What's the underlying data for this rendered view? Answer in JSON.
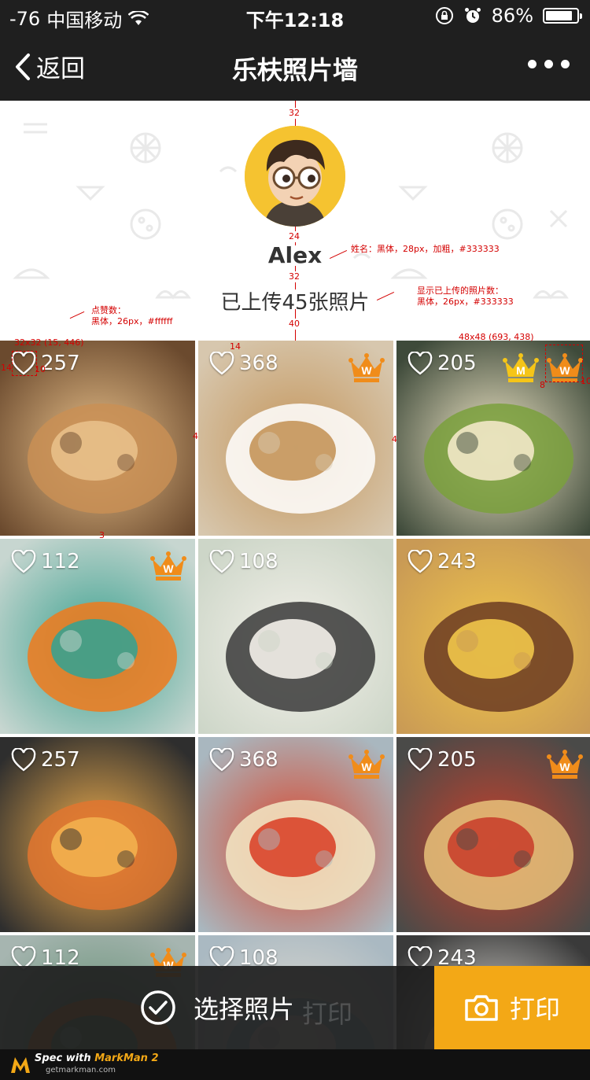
{
  "status_bar": {
    "signal": "-76",
    "carrier": "中国移动",
    "time": "下午12:18",
    "battery": "86%",
    "battery_level": 0.86
  },
  "nav": {
    "back_label": "返回",
    "title": "乐枎照片墙",
    "more_icon": "more-dots-icon"
  },
  "profile": {
    "name": "Alex",
    "upload_text": "已上传45张照片"
  },
  "spec_notes": {
    "top_gap": "32",
    "avatar_gap": "24",
    "name_gap": "32",
    "count_gap": "40",
    "name_note": "姓名：黑体，28px，加粗，#333333",
    "count_note_1": "显示已上传的照片数：",
    "count_note_2": "黑体，26px，#333333",
    "likes_note_1": "点赞数：",
    "likes_note_2": "黑体，26px，#ffffff",
    "heart_size": "32x32 (15, 446)",
    "crown_size": "48x48 (693, 438)",
    "m14a": "14",
    "m10a": "10",
    "m14b": "14",
    "m4a": "4",
    "m4b": "4",
    "m3": "3",
    "m8": "8",
    "m10b": "10",
    "crown_m": "M",
    "crown_w": "W"
  },
  "photos": [
    {
      "likes": "257",
      "crowns": [],
      "theme": "cookies"
    },
    {
      "likes": "368",
      "crowns": [
        "W"
      ],
      "theme": "coffee"
    },
    {
      "likes": "205",
      "crowns": [
        "M",
        "W"
      ],
      "theme": "salad"
    },
    {
      "likes": "112",
      "crowns": [
        "W"
      ],
      "theme": "juice"
    },
    {
      "likes": "108",
      "crowns": [],
      "theme": "rice"
    },
    {
      "likes": "243",
      "crowns": [],
      "theme": "steak"
    },
    {
      "likes": "257",
      "crowns": [],
      "theme": "pasta"
    },
    {
      "likes": "368",
      "crowns": [
        "W"
      ],
      "theme": "soup"
    },
    {
      "likes": "205",
      "crowns": [
        "W"
      ],
      "theme": "pizza"
    },
    {
      "likes": "112",
      "crowns": [
        "W"
      ],
      "theme": "juice2"
    },
    {
      "likes": "108",
      "crowns": [],
      "theme": "bowl"
    },
    {
      "likes": "243",
      "crowns": [],
      "theme": "plate"
    }
  ],
  "actions": {
    "select_label": "选择照片",
    "print_label": "打印",
    "print_ghost": "打印"
  },
  "footer": {
    "brand_prefix": "Spec with ",
    "brand": "MarkMan 2",
    "site": "getmarkman.com"
  },
  "colors": {
    "bar_bg": "#1f1f1f",
    "accent": "#f3a816",
    "crown_orange": "#f08c1a",
    "crown_gold": "#f5c518",
    "spec_red": "#d40000"
  }
}
